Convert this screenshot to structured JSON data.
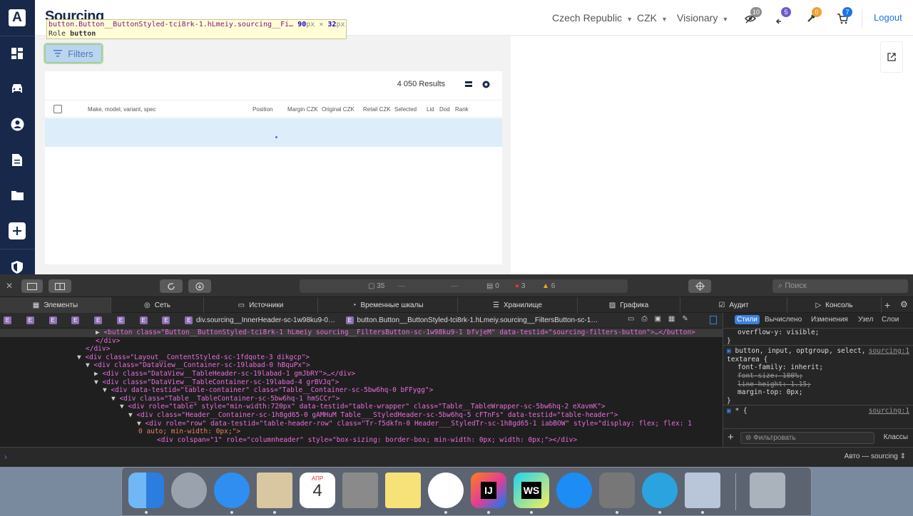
{
  "app": {
    "brand": "Sourcing",
    "header": {
      "country": "Czech Republic",
      "currency": "CZK",
      "profile": "Visionary",
      "badges": [
        {
          "name": "eye-off",
          "count": "10",
          "color": "#8e8e8e"
        },
        {
          "name": "transfer",
          "count": "5",
          "color": "#6b5acd"
        },
        {
          "name": "gavel",
          "count": "0",
          "color": "#f0a030"
        },
        {
          "name": "cart",
          "count": "7",
          "color": "#1a73e8"
        }
      ],
      "logout": "Logout"
    },
    "tooltip": {
      "selector": "button.Button__ButtonStyled-tci8rk-1.hLmeiy.sourcing__Fi…",
      "width": "90",
      "height": "32",
      "unit": "px",
      "times": "×",
      "role_label": "Role",
      "role_value": "button"
    },
    "filters_label": "Filters",
    "table": {
      "results": "4 050 Results",
      "columns": [
        "Make, model, variant, spec",
        "Position",
        "Margin CZK",
        "Original CZK",
        "Retail CZK",
        "Selected",
        "Lid",
        "Dod",
        "Rank"
      ]
    }
  },
  "devtools": {
    "status": {
      "docs": "35",
      "d1": "—",
      "d2": "—",
      "logs": "0",
      "errors": "3",
      "warnings": "6"
    },
    "search_placeholder": "Поиск",
    "tabs": [
      "Элементы",
      "Сеть",
      "Источники",
      "Временные шкалы",
      "Хранилище",
      "Графика",
      "Аудит",
      "Консоль"
    ],
    "breadcrumb_tail": [
      "div.sourcing__InnerHeader-sc-1w98ku9-0…",
      "button.Button__ButtonStyled-tci8rk-1.hLmeiy.sourcing__FiltersButton-sc-1…"
    ],
    "dom_lines": [
      "<button class=\"Button__ButtonStyled-tci8rk-1 hLmeiy sourcing__FiltersButton-sc-1w98ku9-1 bfvjeM\" data-testid=\"sourcing-filters-button\">…</button>",
      "</div>",
      "</div>",
      "<div class=\"Layout__ContentStyled-sc-1fdqote-3 dikgcp\">",
      "<div class=\"DataView__Container-sc-19labad-0 hBquPx\">",
      "<div class=\"DataView__TableHeader-sc-19labad-1 gmJbRY\">…</div>",
      "<div class=\"DataView__TableContainer-sc-19labad-4 grBVJq\">",
      "<div data-testid=\"table-container\" class=\"Table__Container-sc-5bw6hq-0 bFFygg\">",
      "<div class=\"Table__TableContainer-sc-5bw6hq-1 hmSCCr\">",
      "<div role=\"table\" style=\"min-width:720px\" data-testid=\"table-wrapper\" class=\"Table__TableWrapper-sc-5bw6hq-2 eXavmK\">",
      "<div class=\"Header__Container-sc-1h8gd65-0 gAMHuM Table___StyledHeader-sc-5bw6hq-5 cFTnFs\" data-testid=\"table-header\">",
      "<div role=\"row\" data-testid=\"table-header-row\" class=\"Tr-f5dkfn-0 Header___StyledTr-sc-1h8gd65-1 iabBOW\" style=\"display: flex; flex: 1",
      "0 auto; min-width: 0px;\">",
      "<div colspan=\"1\" role=\"columnheader\" style=\"box-sizing: border-box; min-width: 0px; width: 0px;\"></div>"
    ],
    "styles": {
      "tabs": [
        "Стили",
        "Вычислено",
        "Изменения",
        "Узел",
        "Слои"
      ],
      "overflow_line": "overflow-y: visible;",
      "close_brace": "}",
      "rule_selector": "button, input, optgroup, select,",
      "rule_selector2": "textarea {",
      "source": "sourcing:1",
      "props": [
        {
          "text": "font-family: inherit;",
          "strike": false
        },
        {
          "text": "font-size: 100%;",
          "strike": true
        },
        {
          "text": "line-height: 1.15;",
          "strike": true
        },
        {
          "text": "margin-top: 0px;",
          "strike": false
        }
      ],
      "star_rule": "* {",
      "star_source": "sourcing:1",
      "filter_placeholder": "Фильтровать",
      "classes_label": "Классы"
    },
    "console_context": "Авто — sourcing"
  },
  "dock": {
    "apps": [
      {
        "name": "finder",
        "color": "#3d8be8"
      },
      {
        "name": "launchpad",
        "color": "#9aa3ad"
      },
      {
        "name": "safari",
        "color": "#2f8ef0"
      },
      {
        "name": "mail-bird",
        "color": "#d9c7a2"
      },
      {
        "name": "calendar",
        "color": "#ffffff",
        "month": "АПР",
        "day": "4"
      },
      {
        "name": "calculator",
        "color": "#8a8a8a"
      },
      {
        "name": "notes",
        "color": "#f7e27a"
      },
      {
        "name": "slack",
        "color": "#ffffff"
      },
      {
        "name": "intellij",
        "color": "#e63e8f",
        "label": "IJ"
      },
      {
        "name": "webstorm",
        "color": "#1dd2f2",
        "label": "WS"
      },
      {
        "name": "app-store",
        "color": "#1d8cf5"
      },
      {
        "name": "system-preferences",
        "color": "#777"
      },
      {
        "name": "telegram",
        "color": "#2aa3de"
      },
      {
        "name": "preview",
        "color": "#b9c5d8"
      },
      {
        "name": "trash",
        "color": "#aab2bc"
      }
    ]
  }
}
